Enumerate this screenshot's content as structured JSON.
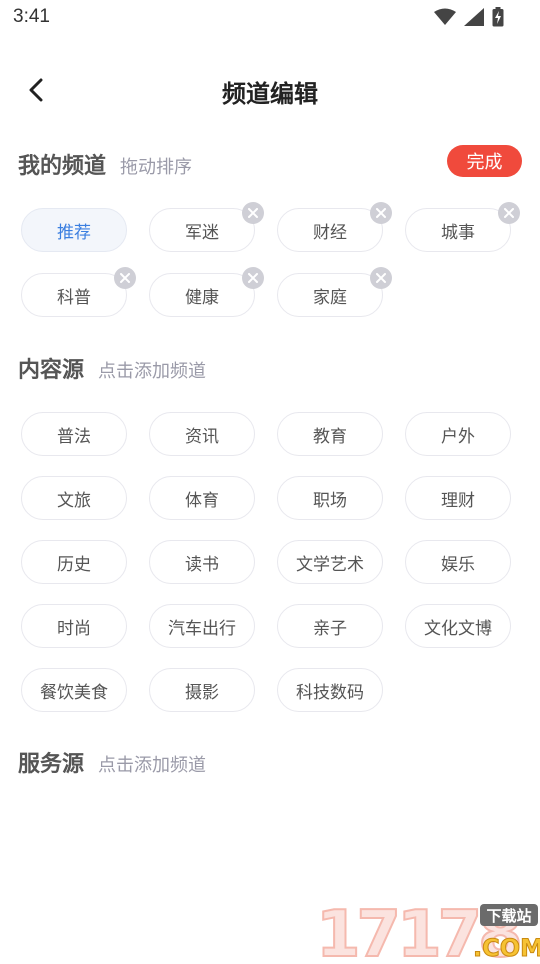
{
  "status_bar": {
    "time": "3:41"
  },
  "header": {
    "title": "频道编辑"
  },
  "my_channels": {
    "title": "我的频道",
    "hint": "拖动排序",
    "done_label": "完成",
    "chips": [
      {
        "label": "推荐",
        "selected": true,
        "removable": false
      },
      {
        "label": "军迷",
        "removable": true
      },
      {
        "label": "财经",
        "removable": true
      },
      {
        "label": "城事",
        "removable": true
      },
      {
        "label": "科普",
        "removable": true
      },
      {
        "label": "健康",
        "removable": true
      },
      {
        "label": "家庭",
        "removable": true
      }
    ]
  },
  "content_sources": {
    "title": "内容源",
    "hint": "点击添加频道",
    "chips": [
      "普法",
      "资讯",
      "教育",
      "户外",
      "文旅",
      "体育",
      "职场",
      "理财",
      "历史",
      "读书",
      "文学艺术",
      "娱乐",
      "时尚",
      "汽车出行",
      "亲子",
      "文化文博",
      "餐饮美食",
      "摄影",
      "科技数码"
    ]
  },
  "service_sources": {
    "title": "服务源",
    "hint": "点击添加频道"
  },
  "watermark": {
    "number": "17178",
    "tag": "下载站",
    "domain": ".COM"
  },
  "colors": {
    "accent_red": "#f04a3c",
    "selected_blue": "#3b7fe0"
  }
}
